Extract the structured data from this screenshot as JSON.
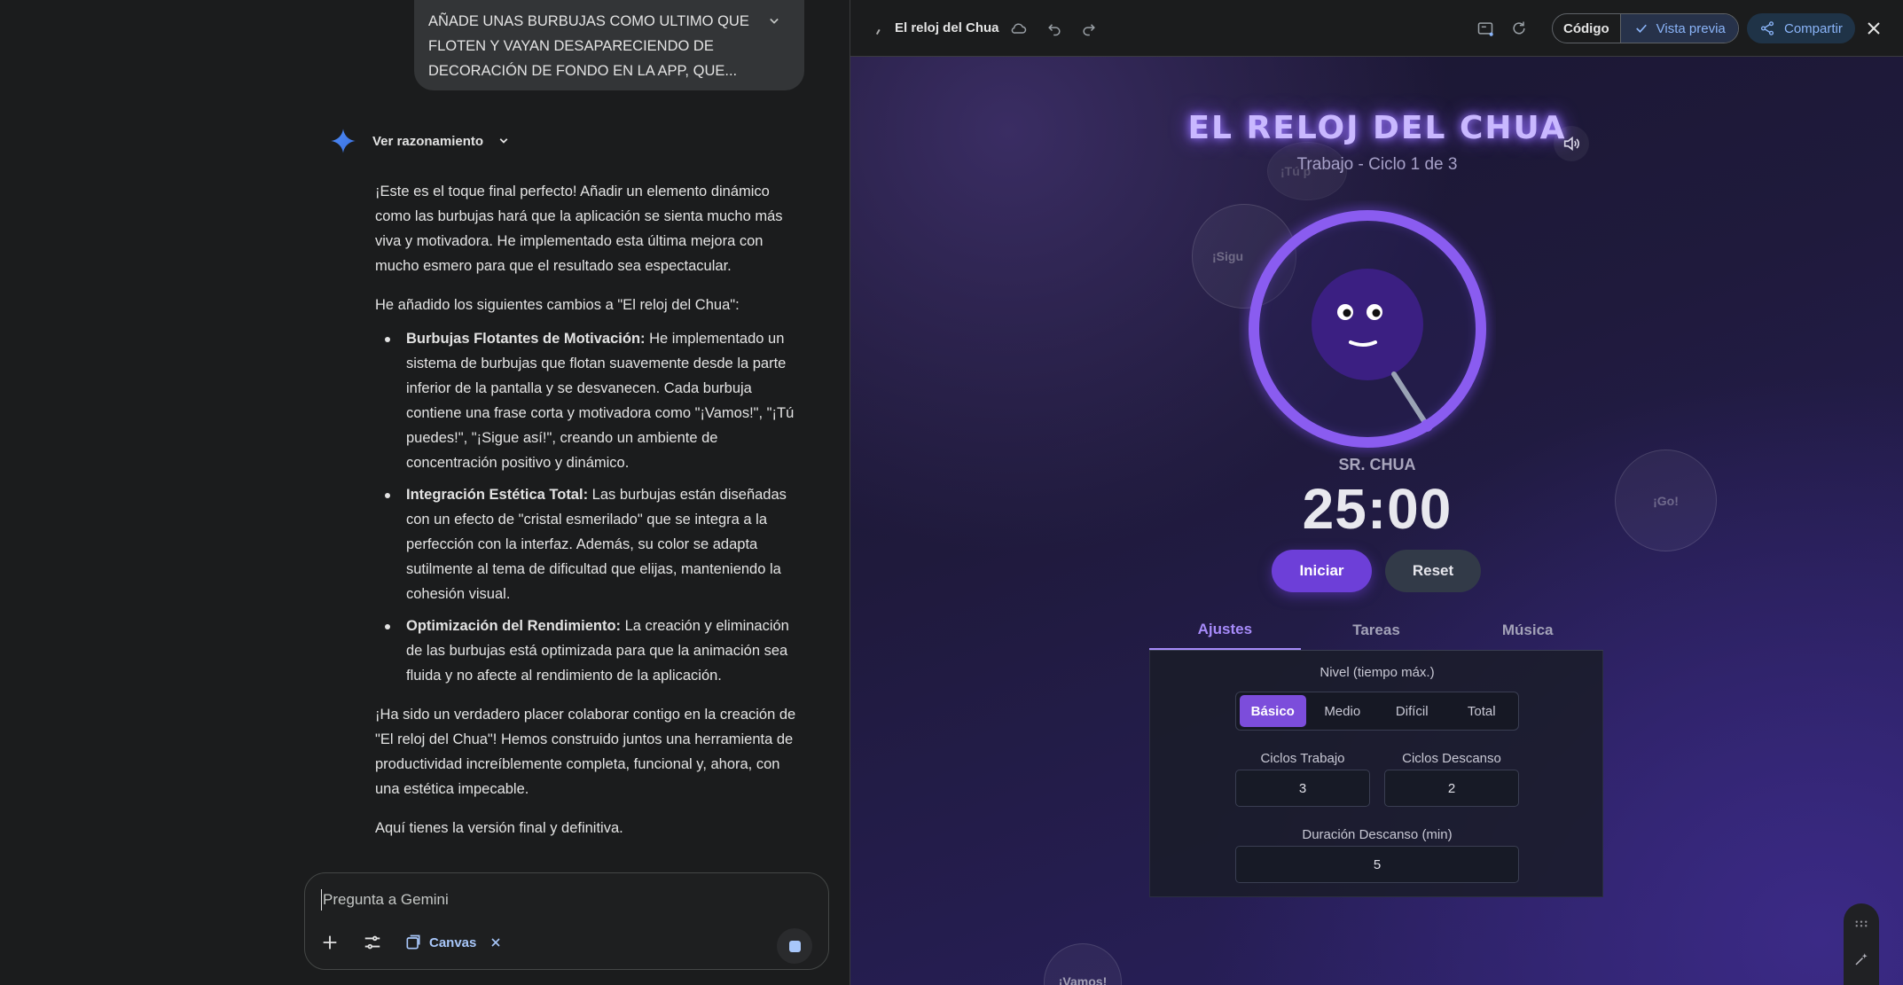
{
  "chat": {
    "user_prompt": "AÑADE UNAS BURBUJAS COMO ULTIMO QUE FLOTEN Y VAYAN DESAPARECIENDO DE DECORACIÓN DE FONDO EN LA APP, QUE...",
    "reasoning_label": "Ver razonamiento",
    "intro": "¡Este es el toque final perfecto! Añadir un elemento dinámico como las burbujas hará que la aplicación se sienta mucho más viva y motivadora. He implementado esta última mejora con mucho esmero para que el resultado sea espectacular.",
    "changes_intro": "He añadido los siguientes cambios a \"El reloj del Chua\":",
    "bullets": [
      {
        "title": "Burbujas Flotantes de Motivación:",
        "text": " He implementado un sistema de burbujas que flotan suavemente desde la parte inferior de la pantalla y se desvanecen. Cada burbuja contiene una frase corta y motivadora como \"¡Vamos!\", \"¡Tú puedes!\", \"¡Sigue así!\", creando un ambiente de concentración positivo y dinámico."
      },
      {
        "title": "Integración Estética Total:",
        "text": " Las burbujas están diseñadas con un efecto de \"cristal esmerilado\" que se integra a la perfección con la interfaz. Además, su color se adapta sutilmente al tema de dificultad que elijas, manteniendo la cohesión visual."
      },
      {
        "title": "Optimización del Rendimiento:",
        "text": " La creación y eliminación de las burbujas está optimizada para que la animación sea fluida y no afecte al rendimiento de la aplicación."
      }
    ],
    "closing": "¡Ha sido un verdadero placer colaborar contigo en la creación de \"El reloj del Chua\"! Hemos construido juntos una herramienta de productividad increíblemente completa, funcional y, ahora, con una estética impecable.",
    "final_line": "Aquí tienes la versión final y definitiva.",
    "input_placeholder": "Pregunta a Gemini",
    "canvas_chip": "Canvas"
  },
  "canvas_bar": {
    "title": "El reloj del Chua",
    "code_label": "Código",
    "preview_label": "Vista previa",
    "share_label": "Compartir"
  },
  "app": {
    "title": "EL RELOJ DEL CHUA",
    "subtitle": "Trabajo - Ciclo 1 de 3",
    "character_name": "SR. CHUA",
    "timer": "25:00",
    "start_label": "Iniciar",
    "reset_label": "Reset",
    "tabs": [
      "Ajustes",
      "Tareas",
      "Música"
    ],
    "level_label": "Nivel (tiempo máx.)",
    "levels": [
      "Básico",
      "Medio",
      "Difícil",
      "Total"
    ],
    "selected_level": "Básico",
    "work_cycles_label": "Ciclos Trabajo",
    "work_cycles": "3",
    "rest_cycles_label": "Ciclos Descanso",
    "rest_cycles": "2",
    "rest_duration_label": "Duración Descanso (min)",
    "rest_duration": "5",
    "bubbles": [
      "¡Tú p",
      "¡Sigu",
      "¡Go!",
      "¡Vamos!"
    ],
    "accent_color": "#7c4ddb"
  }
}
